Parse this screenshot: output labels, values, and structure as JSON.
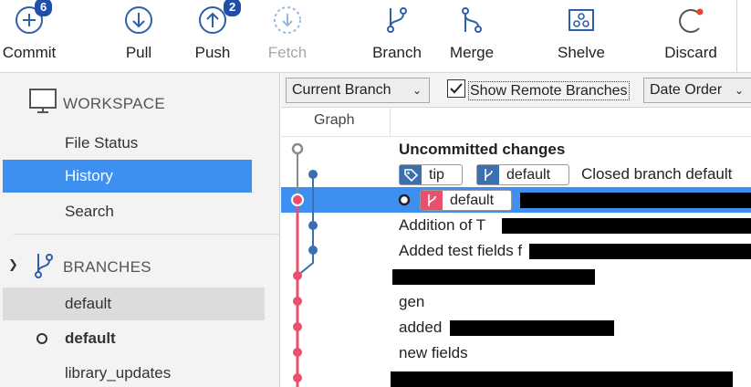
{
  "toolbar": {
    "commit": {
      "label": "Commit",
      "badge": "6",
      "icon": "commit-plus-icon"
    },
    "pull": {
      "label": "Pull",
      "icon": "pull-arrow-down-icon"
    },
    "push": {
      "label": "Push",
      "badge": "2",
      "icon": "push-arrow-up-icon"
    },
    "fetch": {
      "label": "Fetch",
      "icon": "fetch-dashed-icon",
      "disabled": true
    },
    "branch": {
      "label": "Branch",
      "icon": "branch-icon"
    },
    "merge": {
      "label": "Merge",
      "icon": "merge-icon"
    },
    "shelve": {
      "label": "Shelve",
      "icon": "shelve-icon"
    },
    "discard": {
      "label": "Discard",
      "icon": "discard-icon"
    }
  },
  "sidebar": {
    "workspace": {
      "heading": "WORKSPACE",
      "items": [
        {
          "label": "File Status"
        },
        {
          "label": "History",
          "active": true
        },
        {
          "label": "Search"
        }
      ]
    },
    "branches": {
      "heading": "BRANCHES",
      "items": [
        {
          "label": "default"
        },
        {
          "label": "default",
          "current": true
        },
        {
          "label": "library_updates"
        }
      ]
    }
  },
  "filters": {
    "branch_filter": "Current Branch",
    "show_remote_label": "Show Remote Branches",
    "show_remote_checked": true,
    "order": "Date Order"
  },
  "header": {
    "graph_col": "Graph"
  },
  "commits": [
    {
      "message": "Uncommitted changes",
      "bold": true
    },
    {
      "tags": [
        "tip",
        "default"
      ],
      "message": "Closed branch default"
    },
    {
      "tags": [
        "default"
      ],
      "message": "",
      "selected": true
    },
    {
      "message": "Addition of T"
    },
    {
      "message": "Added test fields f"
    },
    {
      "message": ""
    },
    {
      "message": "gen"
    },
    {
      "message": "added "
    },
    {
      "message": "new fields"
    },
    {
      "message": ""
    }
  ],
  "colors": {
    "accent": "#3d8ff0",
    "badge": "#1f4fa8",
    "graph_blue": "#3a6fb0",
    "graph_pink": "#e9506e",
    "graph_gray": "#8a8a8a"
  }
}
